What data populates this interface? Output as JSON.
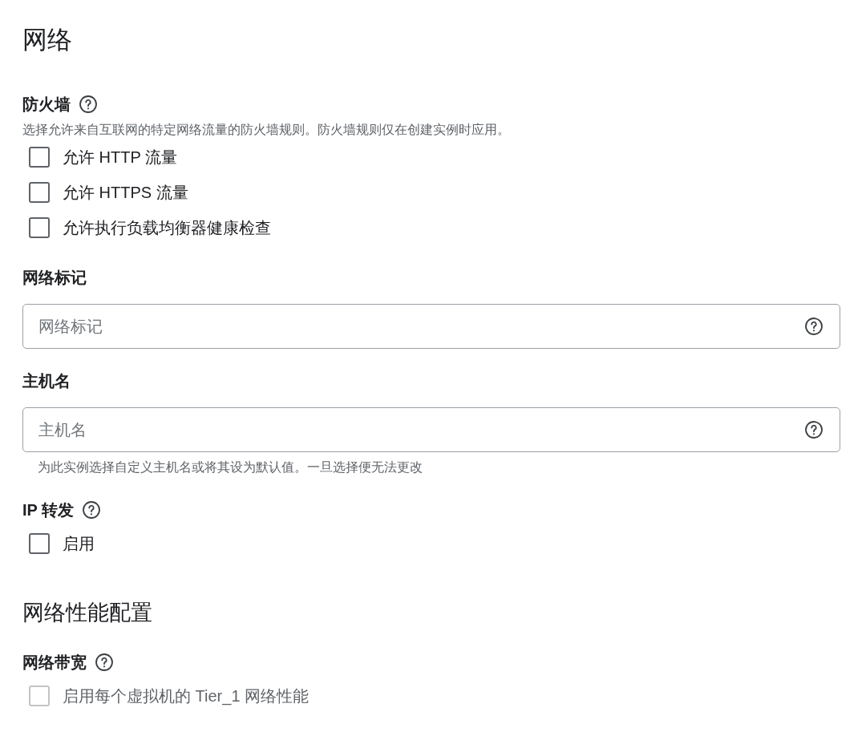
{
  "items": [
    {
      "kind": "heading",
      "text": "网络"
    },
    {
      "kind": "label",
      "text": "防火墙",
      "help": true
    },
    {
      "kind": "description",
      "text": "选择允许来自互联网的特定网络流量的防火墙规则。防火墙规则仅在创建实例时应用。"
    },
    {
      "kind": "checkbox",
      "text": "允许 HTTP 流量",
      "checked": false,
      "disabled": false
    },
    {
      "kind": "checkbox",
      "text": "允许 HTTPS 流量",
      "checked": false,
      "disabled": false
    },
    {
      "kind": "checkbox",
      "text": "允许执行负载均衡器健康检查",
      "checked": false,
      "disabled": false
    },
    {
      "kind": "label",
      "text": "网络标记",
      "help": false
    },
    {
      "kind": "field",
      "placeholder": "网络标记"
    },
    {
      "kind": "label",
      "text": "主机名",
      "help": false
    },
    {
      "kind": "field",
      "placeholder": "主机名"
    },
    {
      "kind": "hint",
      "text": "为此实例选择自定义主机名或将其设为默认值。一旦选择便无法更改"
    },
    {
      "kind": "label",
      "text": "IP 转发",
      "help": true
    },
    {
      "kind": "checkbox",
      "text": "启用",
      "checked": false,
      "disabled": false
    },
    {
      "kind": "subheading",
      "text": "网络性能配置"
    },
    {
      "kind": "label",
      "text": "网络带宽",
      "help": true
    },
    {
      "kind": "checkbox",
      "text": "启用每个虚拟机的 Tier_1 网络性能",
      "checked": false,
      "disabled": true
    }
  ]
}
